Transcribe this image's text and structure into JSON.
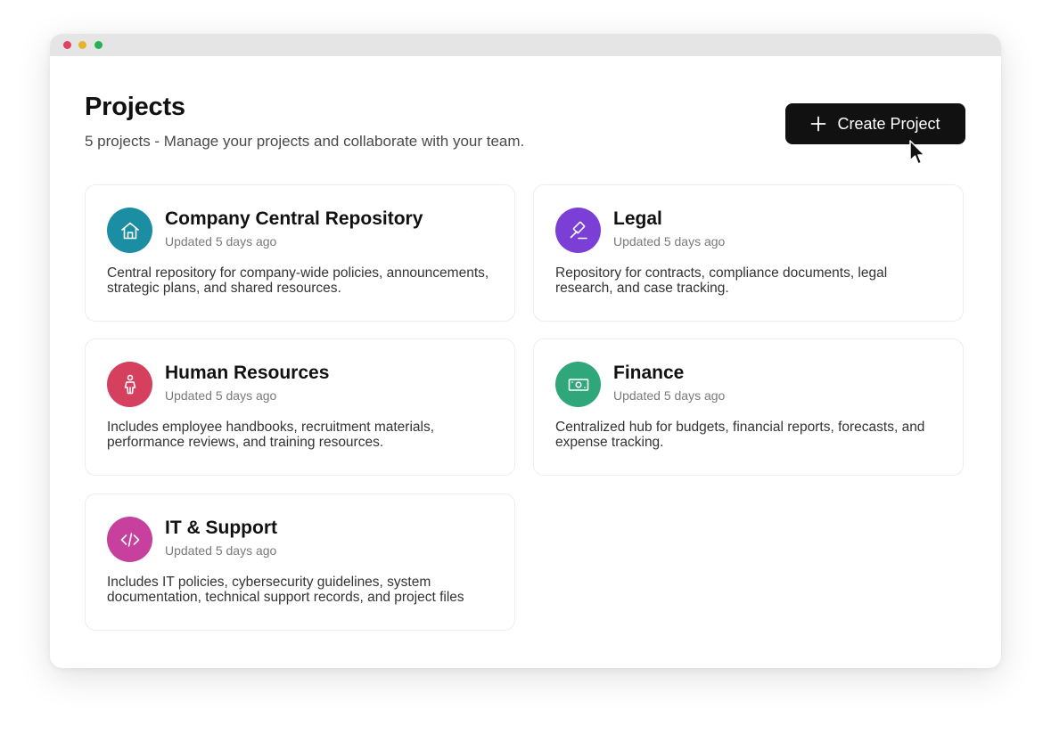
{
  "window": {
    "dots": [
      "#e0445c",
      "#e8b32a",
      "#27b157"
    ]
  },
  "header": {
    "title": "Projects",
    "subtitle": "5 projects - Manage your projects and collaborate with your team.",
    "create_button_label": "Create Project",
    "create_button_color": "#111111"
  },
  "projects": [
    {
      "title": "Company Central Repository",
      "updated": "Updated 5 days ago",
      "description": "Central repository for company-wide policies, announcements, strategic plans, and shared resources.",
      "icon": "home-icon",
      "color": "#1b8ea3"
    },
    {
      "title": "Legal",
      "updated": "Updated 5 days ago",
      "description": "Repository for contracts, compliance documents, legal research, and case tracking.",
      "icon": "gavel-icon",
      "color": "#7b3fd6"
    },
    {
      "title": "Human Resources",
      "updated": "Updated 5 days ago",
      "description": "Includes employee handbooks, recruitment materials, performance reviews, and training resources.",
      "icon": "person-icon",
      "color": "#d4405e"
    },
    {
      "title": "Finance",
      "updated": "Updated 5 days ago",
      "description": "Centralized hub for budgets, financial reports, forecasts, and expense tracking.",
      "icon": "banknote-icon",
      "color": "#2fa77a"
    },
    {
      "title": "IT & Support",
      "updated": "Updated 5 days ago",
      "description": "Includes IT policies, cybersecurity guidelines, system documentation, technical support records, and project files",
      "icon": "code-icon",
      "color": "#c7409e"
    }
  ]
}
